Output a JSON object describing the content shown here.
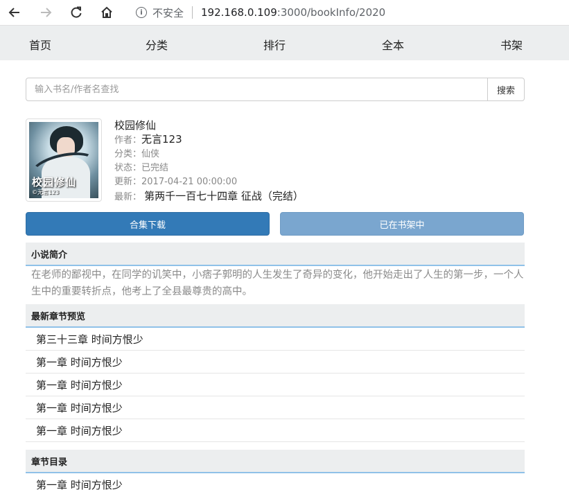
{
  "browser": {
    "insecure_label": "不安全",
    "host": "192.168.0.109",
    "path": ":3000/bookInfo/2020"
  },
  "nav": {
    "items": [
      "首页",
      "分类",
      "排行",
      "全本",
      "书架"
    ]
  },
  "search": {
    "placeholder": "输入书名/作者名查找",
    "button_label": "搜索"
  },
  "book": {
    "cover_title": "校园修仙",
    "cover_author": "©无言123",
    "title": "校园修仙",
    "author_label": "作者：",
    "author": "无言123",
    "category_label": "分类：",
    "category": "仙侠",
    "status_label": "状态：",
    "status": "已完结",
    "updated_label": "更新：",
    "updated": "2017-04-21 00:00:00",
    "latest_label": "最新：",
    "latest": "第两千一百七十四章 征战（完结）"
  },
  "actions": {
    "download_label": "合集下载",
    "shelf_label": "已在书架中"
  },
  "intro": {
    "heading": "小说简介",
    "text": "在老师的鄙视中，在同学的讥笑中，小痞子郭明的人生发生了奇异的变化，他开始走出了人生的第一步，一个人生中的重要转折点，他考上了全县最尊贵的高中。"
  },
  "latest_chapters": {
    "heading": "最新章节预览",
    "items": [
      "第三十三章 时间方恨少",
      "第一章 时间方恨少",
      "第一章 时间方恨少",
      "第一章 时间方恨少",
      "第一章 时间方恨少"
    ]
  },
  "catalog": {
    "heading": "章节目录",
    "items": [
      "第一章 时间方恨少"
    ]
  },
  "colors": {
    "primary": "#337ab7",
    "primary_disabled": "#7aa6cf",
    "section_bg": "#eceeef",
    "section_border": "#8fc1e8"
  }
}
